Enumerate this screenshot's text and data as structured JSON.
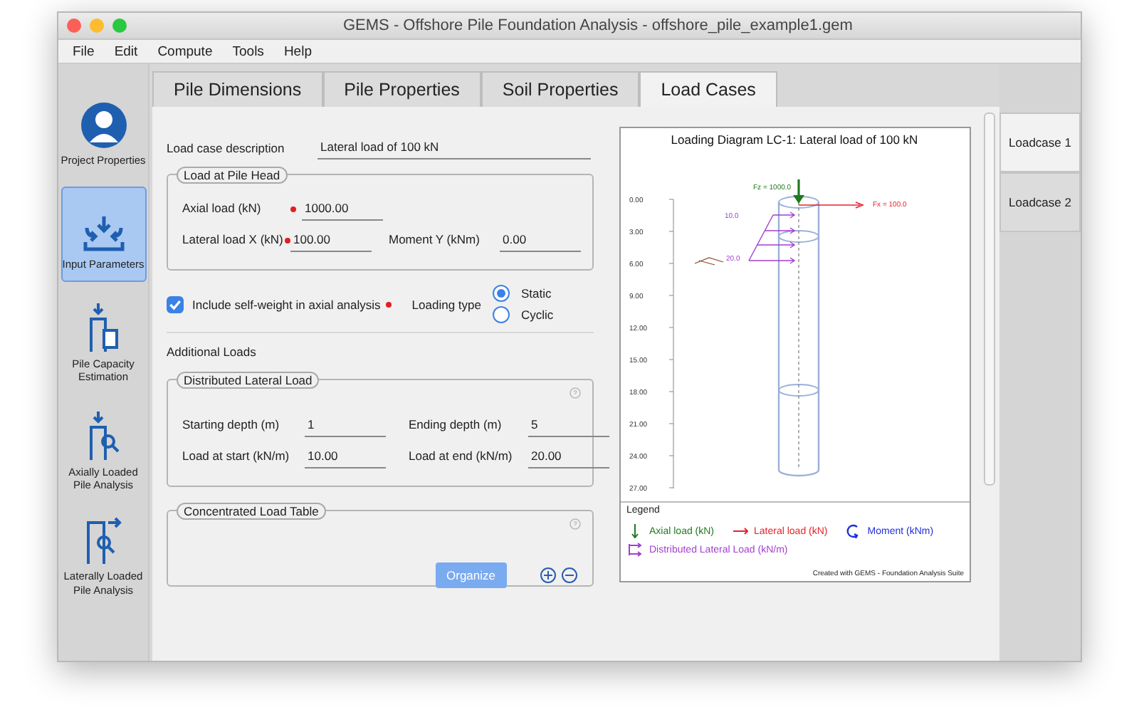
{
  "window": {
    "title": "GEMS - Offshore Pile Foundation Analysis - offshore_pile_example1.gem"
  },
  "menu": [
    "File",
    "Edit",
    "Compute",
    "Tools",
    "Help"
  ],
  "sidebar": [
    {
      "label": "Project Properties",
      "kind": "person",
      "selected": false
    },
    {
      "label": "Input Parameters",
      "kind": "input",
      "selected": true
    },
    {
      "label": "Pile Capacity Estimation",
      "kind": "capacity",
      "selected": false
    },
    {
      "label": "Axially Loaded Pile Analysis",
      "kind": "axial",
      "selected": false
    },
    {
      "label": "Laterally Loaded Pile Analysis",
      "kind": "lateral",
      "selected": false
    }
  ],
  "tabs": [
    {
      "label": "Pile Dimensions",
      "selected": false
    },
    {
      "label": "Pile Properties",
      "selected": false
    },
    {
      "label": "Soil Properties",
      "selected": false
    },
    {
      "label": "Load Cases",
      "selected": true
    }
  ],
  "description": {
    "label": "Load case description",
    "value": "Lateral load of 100 kN"
  },
  "pile_head": {
    "title": "Load at Pile Head",
    "rows": [
      [
        {
          "label": "Axial load (kN)",
          "value": "1000.00",
          "required": true
        }
      ],
      [
        {
          "label": "Lateral load X (kN)",
          "value": "100.00",
          "required": true
        },
        {
          "label": "Moment Y (kNm)",
          "value": "0.00",
          "required": false
        }
      ]
    ]
  },
  "self_weight": {
    "label": "Include self-weight in axial analysis",
    "checked": true,
    "required": true
  },
  "loading_type": {
    "label": "Loading type",
    "options": [
      {
        "label": "Static",
        "selected": true
      },
      {
        "label": "Cyclic",
        "selected": false
      }
    ]
  },
  "additional_loads": "Additional Loads",
  "distributed": {
    "title": "Distributed Lateral Load",
    "rows": [
      [
        {
          "label": "Starting depth (m)",
          "value": "1"
        },
        {
          "label": "Ending depth (m)",
          "value": "5"
        }
      ],
      [
        {
          "label": "Load at start (kN/m)",
          "value": "10.00"
        },
        {
          "label": "Load at end (kN/m)",
          "value": "20.00"
        }
      ]
    ]
  },
  "concentrated": {
    "title": "Concentrated Load Table",
    "button": "Organize"
  },
  "diagram": {
    "title": "Loading Diagram LC-1: Lateral load of 100 kN",
    "depth_ticks": [
      "0.00",
      "3.00",
      "6.00",
      "9.00",
      "12.00",
      "15.00",
      "18.00",
      "21.00",
      "24.00",
      "27.00"
    ],
    "axial_label": "Fz = 1000.0",
    "lateral_label": "Fx = 100.0",
    "dist_start_label": "10.0",
    "dist_end_label": "20.0",
    "legend_title": "Legend",
    "legend": [
      {
        "label": "Axial load (kN)",
        "kind": "axial",
        "color": "#1f7a1f"
      },
      {
        "label": "Lateral load (kN)",
        "kind": "lateral",
        "color": "#e8202a"
      },
      {
        "label": "Moment (kNm)",
        "kind": "moment",
        "color": "#1f2fd8"
      },
      {
        "label": "Distributed Lateral Load (kN/m)",
        "kind": "distributed",
        "color": "#a23fd0"
      }
    ],
    "credit": "Created with GEMS - Foundation Analysis Suite"
  },
  "loadcases": [
    {
      "label": "Loadcase 1",
      "selected": true
    },
    {
      "label": "Loadcase 2",
      "selected": false
    }
  ]
}
